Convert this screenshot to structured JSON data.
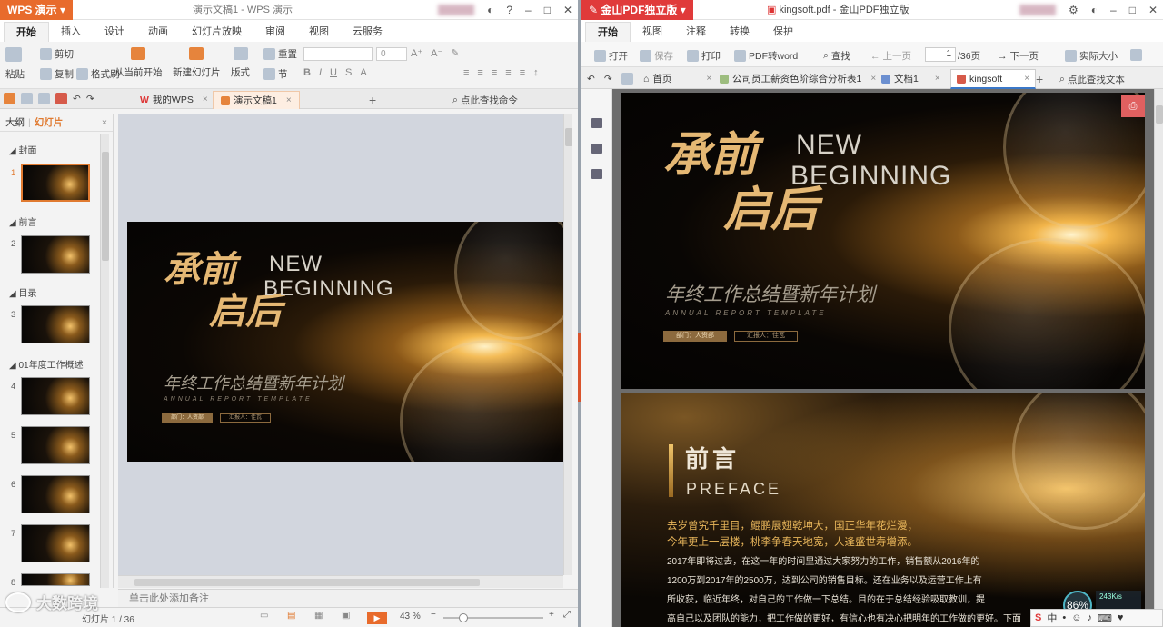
{
  "wps": {
    "app_label": "WPS 演示",
    "window_title": "演示文稿1 - WPS 演示",
    "menu_tabs": [
      "开始",
      "插入",
      "设计",
      "动画",
      "幻灯片放映",
      "审阅",
      "视图",
      "云服务"
    ],
    "ribbon": {
      "paste": "粘贴",
      "cut": "剪切",
      "copy": "复制",
      "format_painter": "格式刷",
      "from_current": "从当前开始",
      "new_slide": "新建幻灯片",
      "layout": "版式",
      "reset": "重置",
      "section": "节",
      "font_size": "0"
    },
    "doc_tabs": [
      "我的WPS",
      "演示文稿1"
    ],
    "search_label": "点此查找命令",
    "panel_tabs": [
      "大纲",
      "幻灯片"
    ],
    "sections": [
      "封面",
      "前言",
      "目录",
      "01年度工作概述"
    ],
    "slide_numbers": [
      "1",
      "2",
      "3",
      "4",
      "5",
      "6",
      "7",
      "8"
    ],
    "notes_placeholder": "单击此处添加备注",
    "status": {
      "slide_info": "幻灯片 1 / 36",
      "zoom": "43 %"
    }
  },
  "slide": {
    "cn_title_1": "承前",
    "cn_title_2": "启后",
    "en_title_1": "NEW",
    "en_title_2": "BEGINNING",
    "cn_subtitle": "年终工作总结暨新年计划",
    "en_subtitle": "ANNUAL REPORT TEMPLATE",
    "pill_1": "部门：人资部",
    "pill_2": "汇报人：佳瓦"
  },
  "pdf": {
    "app_label": "金山PDF独立版",
    "window_title": "kingsoft.pdf - 金山PDF独立版",
    "menu_tabs": [
      "开始",
      "视图",
      "注释",
      "转换",
      "保护"
    ],
    "toolbar": {
      "open": "打开",
      "save": "保存",
      "print": "打印",
      "pdf_to_word": "PDF转word",
      "find": "查找",
      "prev_page": "上一页",
      "page_current": "1",
      "page_total": "/36页",
      "next_page": "下一页",
      "actual_size": "实际大小"
    },
    "tabs": [
      "首页",
      "公司员工薪资色阶综合分析表1",
      "文档1",
      "kingsoft"
    ],
    "search_label": "点此查找文本",
    "preface_cn": "前言",
    "preface_en": "PREFACE",
    "para_gold_1": "去岁曾究千里目，鲲鹏展翅乾坤大，国正华年花烂漫；",
    "para_gold_2": "今年更上一层楼，桃李争春天地宽，人逢盛世寿增添。",
    "para_1": "2017年即将过去，在这一年的时间里通过大家努力的工作，销售额从2016年的",
    "para_2": "1200万到2017年的2500万，达到公司的销售目标。还在业务以及运营工作上有",
    "para_3": "所收获，临近年终，对自己的工作做一下总结。目的在于总结经验吸取教训，提",
    "para_4": "高自己以及团队的能力，把工作做的更好，有信心也有决心把明年的工作做的更好。下面",
    "zoom_badge": "86%",
    "net_speed": "243K/s",
    "ime_label": "中"
  },
  "watermark": "大数跨境"
}
